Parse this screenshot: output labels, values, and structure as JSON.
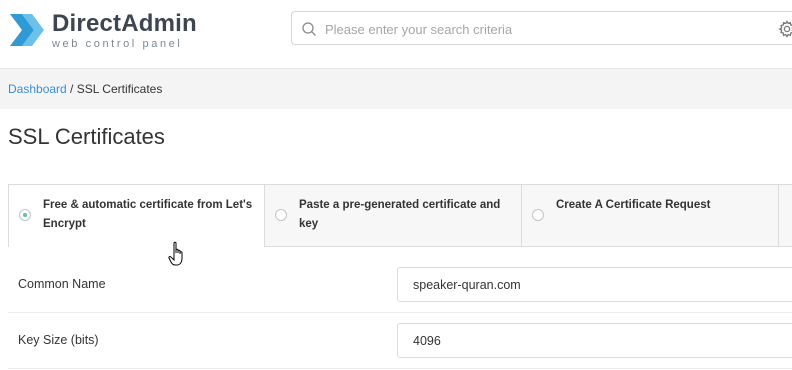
{
  "header": {
    "brand": "DirectAdmin",
    "tagline": "web control panel",
    "search": {
      "placeholder": "Please enter your search criteria",
      "value": ""
    },
    "icons": {
      "logo": "directadmin-logo-icon",
      "search": "search-icon",
      "settings": "gear-icon"
    }
  },
  "breadcrumb": {
    "home": "Dashboard",
    "separator": " / ",
    "current": "SSL Certificates"
  },
  "page": {
    "title": "SSL Certificates"
  },
  "tabs": [
    {
      "label": "Free & automatic certificate from Let's Encrypt",
      "selected": true
    },
    {
      "label": "Paste a pre-generated certificate and key",
      "selected": false
    },
    {
      "label": "Create A Certificate Request",
      "selected": false
    },
    {
      "label": "",
      "selected": false
    }
  ],
  "form": {
    "common_name": {
      "label": "Common Name",
      "value": "speaker-quran.com"
    },
    "key_size": {
      "label": "Key Size (bits)",
      "value": "4096"
    }
  },
  "colors": {
    "accent": "#3a8fd2",
    "logo": "#2e9bd6",
    "radio_selected": "#5bc49a",
    "breadcrumb_bg": "#f4f4f4"
  }
}
